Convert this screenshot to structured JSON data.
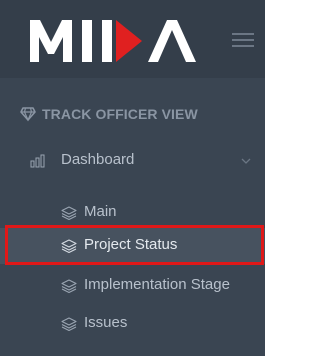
{
  "brand": {
    "logo_text": "MIDA",
    "accent_color": "#e02020",
    "sidebar_bg": "#3a4552",
    "header_bg": "#343e4a"
  },
  "header": {
    "menu_icon": "hamburger-menu-icon"
  },
  "sidebar": {
    "section_title": "TRACK OFFICER VIEW",
    "section_icon": "diamond-icon",
    "dashboard": {
      "label": "Dashboard",
      "icon": "bar-chart-icon",
      "chevron_icon": "chevron-down-icon",
      "expanded": true
    },
    "sub_items": [
      {
        "label": "Main",
        "icon": "layers-icon",
        "active": false
      },
      {
        "label": "Project Status",
        "icon": "layers-icon",
        "active": true
      },
      {
        "label": "Implementation Stage",
        "icon": "layers-icon",
        "active": false
      },
      {
        "label": "Issues",
        "icon": "layers-icon",
        "active": false
      }
    ]
  },
  "annotation": {
    "highlight_color": "#e01818",
    "highlighted_item": "Project Status"
  }
}
